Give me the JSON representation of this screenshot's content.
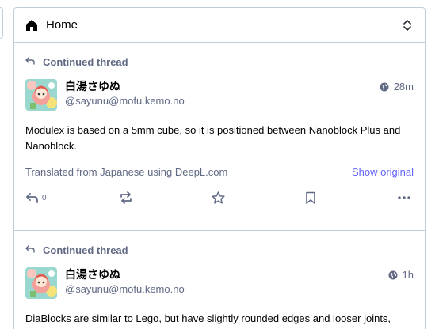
{
  "column": {
    "title": "Home",
    "home_icon": "home-icon",
    "collapse_icon": "chevron-up-down-icon"
  },
  "statuses": [
    {
      "prepend": "Continued thread",
      "display_name": "白湯さゆぬ",
      "acct": "@sayunu@mofu.kemo.no",
      "visibility_icon": "globe-icon",
      "time": "28m",
      "content": "Modulex is based on a 5mm cube, so it is positioned between Nanoblock Plus and Nanoblock.",
      "translation_label": "Translated from Japanese using DeepL.com",
      "show_original": "Show original",
      "reply_count": "0"
    },
    {
      "prepend": "Continued thread",
      "display_name": "白湯さゆぬ",
      "acct": "@sayunu@mofu.kemo.no",
      "visibility_icon": "globe-icon",
      "time": "1h",
      "content": "DiaBlocks are similar to Lego, but have slightly rounded edges and looser joints, making them more suitable for toddlers than Lego. It is not marketed overseas."
    }
  ],
  "colors": {
    "accent": "#6364ff",
    "muted": "#606984",
    "border": "#c0cdd9"
  }
}
